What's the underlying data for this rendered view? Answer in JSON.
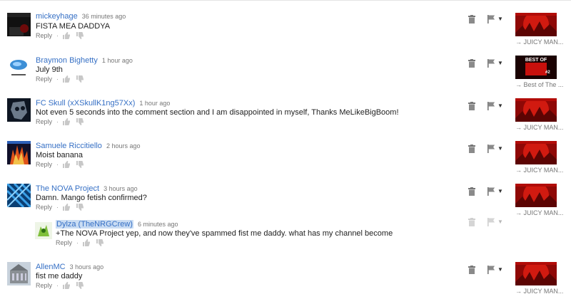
{
  "comments": [
    {
      "author": "mickeyhage",
      "time": "36 minutes ago",
      "text": "FISTA MEA DADDYA",
      "reply": "Reply",
      "thumb_caption": "→ JUICY MAN..."
    },
    {
      "author": "Braymon Bighetty",
      "time": "1 hour ago",
      "text": "July 9th",
      "reply": "Reply",
      "thumb_caption": "→ Best of The ...",
      "thumb_title": "BEST OF",
      "thumb_badge": "#2"
    },
    {
      "author": "FC Skull (xXSkullK1ng57Xx)",
      "time": "1 hour ago",
      "text": "Not even 5 seconds into the comment section and I am disappointed in myself, Thanks MeLikeBigBoom!",
      "reply": "Reply",
      "thumb_caption": "→ JUICY MAN..."
    },
    {
      "author": "Samuele Riccitiello",
      "time": "2 hours ago",
      "text": "Moist banana",
      "reply": "Reply",
      "thumb_caption": "→ JUICY MAN..."
    },
    {
      "author": "The NOVA Project",
      "time": "3 hours ago",
      "text": "Damn. Mango fetish confirmed?",
      "reply": "Reply",
      "thumb_caption": "→ JUICY MAN..."
    },
    {
      "author": "Dylza (TheNRGCrew)",
      "time": "6 minutes ago",
      "text": "+The NOVA Project yep, and now they've spammed fist me daddy. what has my channel become",
      "reply": "Reply"
    },
    {
      "author": "AllenMC",
      "time": "3 hours ago",
      "text": "fist me daddy",
      "reply": "Reply",
      "thumb_caption": "→ JUICY MAN..."
    }
  ],
  "colors": {
    "author": "#3670c5",
    "meta": "#777777",
    "thumb_red": "#c8100c"
  }
}
